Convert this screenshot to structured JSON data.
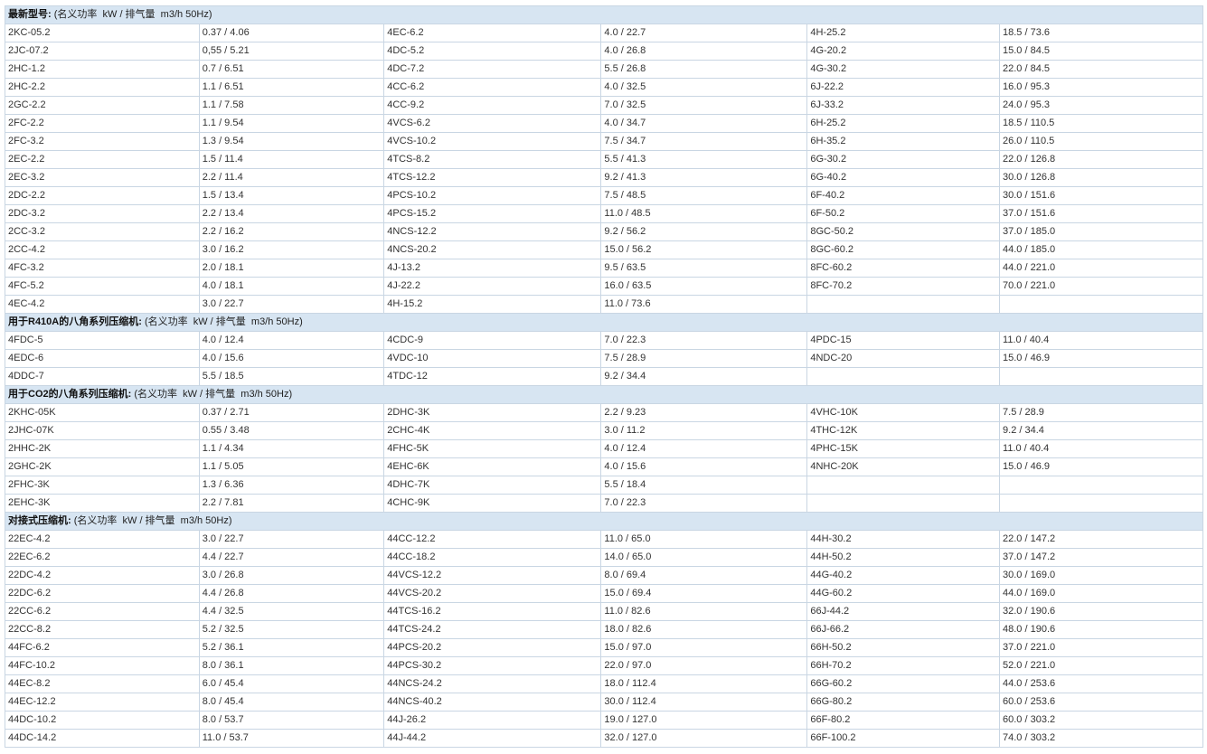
{
  "sections": [
    {
      "title": "最新型号:",
      "note": " (名义功率  kW / 排气量  m3/h 50Hz)",
      "rows": [
        [
          "2KC-05.2",
          "0.37 / 4.06",
          "4EC-6.2",
          "4.0 / 22.7",
          "4H-25.2",
          "18.5 / 73.6"
        ],
        [
          "2JC-07.2",
          "0,55 / 5.21",
          "4DC-5.2",
          "4.0 / 26.8",
          "4G-20.2",
          "15.0 / 84.5"
        ],
        [
          "2HC-1.2",
          "0.7 / 6.51",
          "4DC-7.2",
          "5.5 / 26.8",
          "4G-30.2",
          "22.0 / 84.5"
        ],
        [
          "2HC-2.2",
          "1.1 / 6.51",
          "4CC-6.2",
          "4.0 / 32.5",
          "6J-22.2",
          "16.0 / 95.3"
        ],
        [
          "2GC-2.2",
          "1.1 / 7.58",
          "4CC-9.2",
          "7.0 / 32.5",
          "6J-33.2",
          "24.0 / 95.3"
        ],
        [
          "2FC-2.2",
          "1.1 / 9.54",
          "4VCS-6.2",
          "4.0 / 34.7",
          "6H-25.2",
          "18.5 / 110.5"
        ],
        [
          "2FC-3.2",
          "1.3 / 9.54",
          "4VCS-10.2",
          "7.5 / 34.7",
          "6H-35.2",
          "26.0 / 110.5"
        ],
        [
          "2EC-2.2",
          "1.5 / 11.4",
          "4TCS-8.2",
          "5.5 / 41.3",
          "6G-30.2",
          "22.0 / 126.8"
        ],
        [
          "2EC-3.2",
          "2.2 / 11.4",
          "4TCS-12.2",
          "9.2 / 41.3",
          "6G-40.2",
          "30.0 / 126.8"
        ],
        [
          "2DC-2.2",
          "1.5 / 13.4",
          "4PCS-10.2",
          "7.5 / 48.5",
          "6F-40.2",
          "30.0 / 151.6"
        ],
        [
          "2DC-3.2",
          "2.2 / 13.4",
          "4PCS-15.2",
          "11.0 / 48.5",
          "6F-50.2",
          "37.0 / 151.6"
        ],
        [
          "2CC-3.2",
          "2.2 / 16.2",
          "4NCS-12.2",
          "9.2 / 56.2",
          "8GC-50.2",
          "37.0 / 185.0"
        ],
        [
          "2CC-4.2",
          "3.0 / 16.2",
          "4NCS-20.2",
          "15.0 / 56.2",
          "8GC-60.2",
          "44.0 / 185.0"
        ],
        [
          "4FC-3.2",
          "2.0 / 18.1",
          "4J-13.2",
          "9.5 / 63.5",
          "8FC-60.2",
          "44.0 / 221.0"
        ],
        [
          "4FC-5.2",
          "4.0 / 18.1",
          "4J-22.2",
          "16.0 / 63.5",
          "8FC-70.2",
          "70.0 / 221.0"
        ],
        [
          "4EC-4.2",
          "3.0 / 22.7",
          "4H-15.2",
          "11.0 / 73.6",
          "",
          ""
        ]
      ]
    },
    {
      "title": "用于R410A的八角系列压缩机:",
      "note": " (名义功率  kW / 排气量  m3/h 50Hz)",
      "rows": [
        [
          "4FDC-5",
          "4.0 / 12.4",
          "4CDC-9",
          "7.0 / 22.3",
          "4PDC-15",
          "11.0 / 40.4"
        ],
        [
          "4EDC-6",
          "4.0 / 15.6",
          "4VDC-10",
          "7.5 / 28.9",
          "4NDC-20",
          "15.0 / 46.9"
        ],
        [
          "4DDC-7",
          "5.5 / 18.5",
          "4TDC-12",
          "9.2 / 34.4",
          "",
          ""
        ]
      ]
    },
    {
      "title": "用于CO2的八角系列压缩机:",
      "note": " (名义功率  kW / 排气量  m3/h 50Hz)",
      "rows": [
        [
          "2KHC-05K",
          "0.37 / 2.71",
          "2DHC-3K",
          "2.2 / 9.23",
          "4VHC-10K",
          "7.5 / 28.9"
        ],
        [
          "2JHC-07K",
          "0.55 / 3.48",
          "2CHC-4K",
          "3.0 / 11.2",
          "4THC-12K",
          "9.2 / 34.4"
        ],
        [
          "2HHC-2K",
          "1.1 / 4.34",
          "4FHC-5K",
          "4.0 / 12.4",
          "4PHC-15K",
          "11.0 / 40.4"
        ],
        [
          "2GHC-2K",
          "1.1 / 5.05",
          "4EHC-6K",
          "4.0 / 15.6",
          "4NHC-20K",
          "15.0 / 46.9"
        ],
        [
          "2FHC-3K",
          "1.3 / 6.36",
          "4DHC-7K",
          "5.5 / 18.4",
          "",
          ""
        ],
        [
          "2EHC-3K",
          "2.2 / 7.81",
          "4CHC-9K",
          "7.0 / 22.3",
          "",
          ""
        ]
      ]
    },
    {
      "title": "对接式压缩机:",
      "note": " (名义功率  kW / 排气量  m3/h 50Hz)",
      "rows": [
        [
          "22EC-4.2",
          "3.0 / 22.7",
          "44CC-12.2",
          "11.0 / 65.0",
          "44H-30.2",
          "22.0 / 147.2"
        ],
        [
          "22EC-6.2",
          "4.4 / 22.7",
          "44CC-18.2",
          "14.0 / 65.0",
          "44H-50.2",
          "37.0 / 147.2"
        ],
        [
          "22DC-4.2",
          "3.0 / 26.8",
          "44VCS-12.2",
          "8.0 / 69.4",
          "44G-40.2",
          "30.0 / 169.0"
        ],
        [
          "22DC-6.2",
          "4.4 / 26.8",
          "44VCS-20.2",
          "15.0 / 69.4",
          "44G-60.2",
          "44.0 / 169.0"
        ],
        [
          "22CC-6.2",
          "4.4 / 32.5",
          "44TCS-16.2",
          "11.0 / 82.6",
          "66J-44.2",
          "32.0 / 190.6"
        ],
        [
          "22CC-8.2",
          "5.2 / 32.5",
          "44TCS-24.2",
          "18.0 / 82.6",
          "66J-66.2",
          "48.0 / 190.6"
        ],
        [
          "44FC-6.2",
          "5.2 / 36.1",
          "44PCS-20.2",
          "15.0 / 97.0",
          "66H-50.2",
          "37.0 / 221.0"
        ],
        [
          "44FC-10.2",
          "8.0 / 36.1",
          "44PCS-30.2",
          "22.0 / 97.0",
          "66H-70.2",
          "52.0 / 221.0"
        ],
        [
          "44EC-8.2",
          "6.0 / 45.4",
          "44NCS-24.2",
          "18.0 / 112.4",
          "66G-60.2",
          "44.0 / 253.6"
        ],
        [
          "44EC-12.2",
          "8.0 / 45.4",
          "44NCS-40.2",
          "30.0 / 112.4",
          "66G-80.2",
          "60.0 / 253.6"
        ],
        [
          "44DC-10.2",
          "8.0 / 53.7",
          "44J-26.2",
          "19.0 / 127.0",
          "66F-80.2",
          "60.0 / 303.2"
        ],
        [
          "44DC-14.2",
          "11.0 / 53.7",
          "44J-44.2",
          "32.0 / 127.0",
          "66F-100.2",
          "74.0 / 303.2"
        ]
      ]
    }
  ]
}
